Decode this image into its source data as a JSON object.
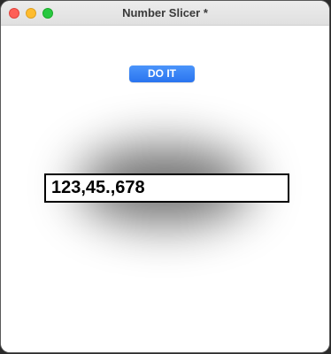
{
  "window": {
    "title": "Number Slicer *"
  },
  "toolbar": {
    "do_it_label": "DO IT"
  },
  "field": {
    "value": "123,45.,678"
  },
  "colors": {
    "button_accent": "#2f7cf6",
    "traffic_close": "#fe5f57",
    "traffic_minimize": "#febc2e",
    "traffic_maximize": "#28c840"
  }
}
